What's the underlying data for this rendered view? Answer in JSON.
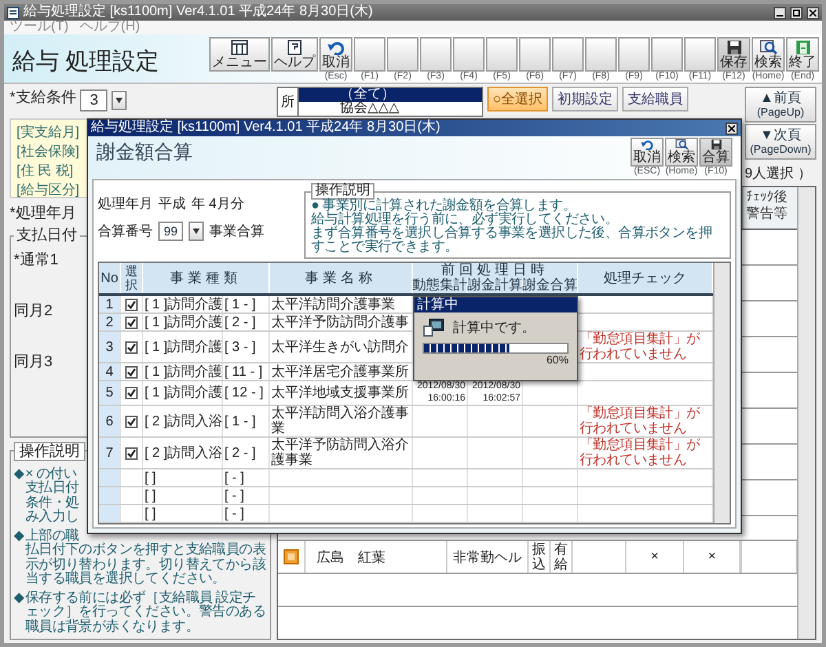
{
  "window": {
    "title": "給与処理設定 [ks1100m] Ver4.1.01 平成24年 8月30日(木)"
  },
  "menu": [
    "ツール(T)",
    "ヘルプ(H)"
  ],
  "header": {
    "title": "給与 処理設定"
  },
  "toolbar": [
    {
      "kind": "menu",
      "label": "メニュー"
    },
    {
      "kind": "help",
      "label": "ヘルプ"
    },
    {
      "kind": "undo",
      "label": "取消",
      "key": "(Esc)"
    },
    {
      "kind": "blank",
      "key": "(F1)"
    },
    {
      "kind": "blank",
      "key": "(F2)"
    },
    {
      "kind": "blank",
      "key": "(F3)"
    },
    {
      "kind": "blank",
      "key": "(F4)"
    },
    {
      "kind": "blank",
      "key": "(F5)"
    },
    {
      "kind": "blank",
      "key": "(F6)"
    },
    {
      "kind": "blank",
      "key": "(F7)"
    },
    {
      "kind": "blank",
      "key": "(F8)"
    },
    {
      "kind": "blank",
      "key": "(F9)"
    },
    {
      "kind": "blank",
      "key": "(F10)"
    },
    {
      "kind": "blank",
      "key": "(F11)"
    },
    {
      "kind": "save",
      "label": "保存",
      "key": "(F12)"
    },
    {
      "kind": "search",
      "label": "検索",
      "key": "(Home)"
    },
    {
      "kind": "exit",
      "label": "終了",
      "key": "(End)"
    }
  ],
  "pay_condition": {
    "label": "*支給条件",
    "value": "3"
  },
  "info_labels": [
    "[実支給月]",
    "[社会保険]",
    "[住 民 税]",
    "[給与区分]"
  ],
  "period_label": "*処理年月",
  "pay_dates": {
    "legend": "支払日付",
    "rows": [
      "*通常1",
      "同月2",
      "同月3"
    ]
  },
  "help": {
    "legend": "操作説明",
    "bullets": [
      {
        "marker": "◆",
        "lines": [
          "× の付い",
          "支払日付",
          "条件・処",
          "み入力し"
        ]
      },
      {
        "marker": "◆",
        "lines": [
          "上部の職"
        ],
        "text": "払日付下のボタンを押すと支給職員の表示が切り替わります。切り替えてから該当する職員を選択してください。"
      },
      {
        "marker": "◆",
        "text": "保存する前には必ず［支給職員 設定チェック］を行ってください。警告のある職員は背景が赤くなります。"
      }
    ]
  },
  "office_list": {
    "label": "所",
    "items": [
      {
        "text": "（全て）",
        "selected": true
      },
      {
        "text": "協会△△△",
        "selected": false
      }
    ]
  },
  "buttons": [
    {
      "label": "○全選択",
      "kind": "primary"
    },
    {
      "label": "初期設定",
      "kind": "plain"
    },
    {
      "label": "支給職員",
      "kind": "plain"
    }
  ],
  "paging": [
    {
      "label": "▲前頁",
      "key": "(PageUp)"
    },
    {
      "label": "▼次頁",
      "key": "(PageDown)"
    }
  ],
  "selection_count": "9人選択 ）",
  "staff_table": {
    "check_column": [
      "ﾁｪｯｸ後",
      "警告等"
    ],
    "row": {
      "warning": true,
      "name": "広島　紅葉",
      "type": "非常勤ヘル",
      "transfer": "振込",
      "leave": "有給",
      "marks": [
        "×",
        "×"
      ]
    }
  },
  "dialog": {
    "title": "給与処理設定 [ks1100m] Ver4.1.01 平成24年 8月30日(木)",
    "heading": "謝金額合算",
    "toolbar": [
      {
        "kind": "undo",
        "label": "取消",
        "key": "(ESC)"
      },
      {
        "kind": "search",
        "label": "検索",
        "key": "(Home)"
      },
      {
        "kind": "merge",
        "label": "合算",
        "key": "(F10)"
      }
    ],
    "period": {
      "label": "処理年月",
      "era": "平成",
      "value": "年 4月分"
    },
    "group_no": {
      "label": "合算番号",
      "value": "99",
      "caption": "事業合算"
    },
    "help": {
      "legend": "操作説明",
      "lines": [
        "● 事業別に計算された謝金額を合算します。",
        "給与計算処理を行う前に、必ず実行してください。",
        "まず合算番号を選択し合算する事業を選択した後、合算ボタンを押すことで実行できます。"
      ]
    },
    "table": {
      "columns": {
        "no": "No",
        "select": "選択",
        "type": "事業種類",
        "name": "事業名称",
        "group": "前回処理日時",
        "tally": "動態集計",
        "calc": "謝金計算",
        "merge": "謝金合算",
        "check": "処理チェック"
      },
      "rows": [
        {
          "kind": "business",
          "no": "1",
          "checked": true,
          "type": "[ 1 ]訪問介護",
          "code": "[ 1 - ]",
          "name": "太平洋訪問介護事業"
        },
        {
          "kind": "business",
          "no": "2",
          "checked": true,
          "type": "[ 1 ]訪問介護",
          "code": "[ 2 - ]",
          "name": "太平洋予防訪問介護事"
        },
        {
          "kind": "business",
          "no": "3",
          "checked": true,
          "type": "[ 1 ]訪問介護",
          "code": "[ 3 - ]",
          "name": "太平洋生きがい訪問介",
          "check": "「勤怠項目集計」が行われていません"
        },
        {
          "kind": "business",
          "no": "4",
          "checked": true,
          "type": "[ 1 ]訪問介護",
          "code": "[ 11 - ]",
          "name": "太平洋居宅介護事業所"
        },
        {
          "kind": "business",
          "no": "5",
          "checked": true,
          "type": "[ 1 ]訪問介護",
          "code": "[ 12 - ]",
          "name": "太平洋地域支援事業所",
          "tally": "2012/08/30 16:00:16",
          "calc": "2012/08/30 16:02:57"
        },
        {
          "kind": "business",
          "no": "6",
          "checked": true,
          "type": "[ 2 ]訪問入浴",
          "code": "[ 1 - ]",
          "name": "太平洋訪問入浴介護事業",
          "check": "「勤怠項目集計」が行われていません"
        },
        {
          "kind": "business",
          "no": "7",
          "checked": true,
          "type": "[ 2 ]訪問入浴",
          "code": "[ 2 - ]",
          "name": "太平洋予防訪問入浴介護事業",
          "check": "「勤怠項目集計」が行われていません"
        },
        {
          "kind": "empty",
          "type": "[ ]",
          "code": "[ - ]"
        },
        {
          "kind": "empty",
          "type": "[ ]",
          "code": "[ - ]"
        },
        {
          "kind": "empty",
          "type": "[ ]",
          "code": "[ - ]"
        }
      ]
    },
    "progress": {
      "title": "計算中",
      "message": "計算中です。",
      "level": 0.6,
      "reading": "60%"
    }
  }
}
